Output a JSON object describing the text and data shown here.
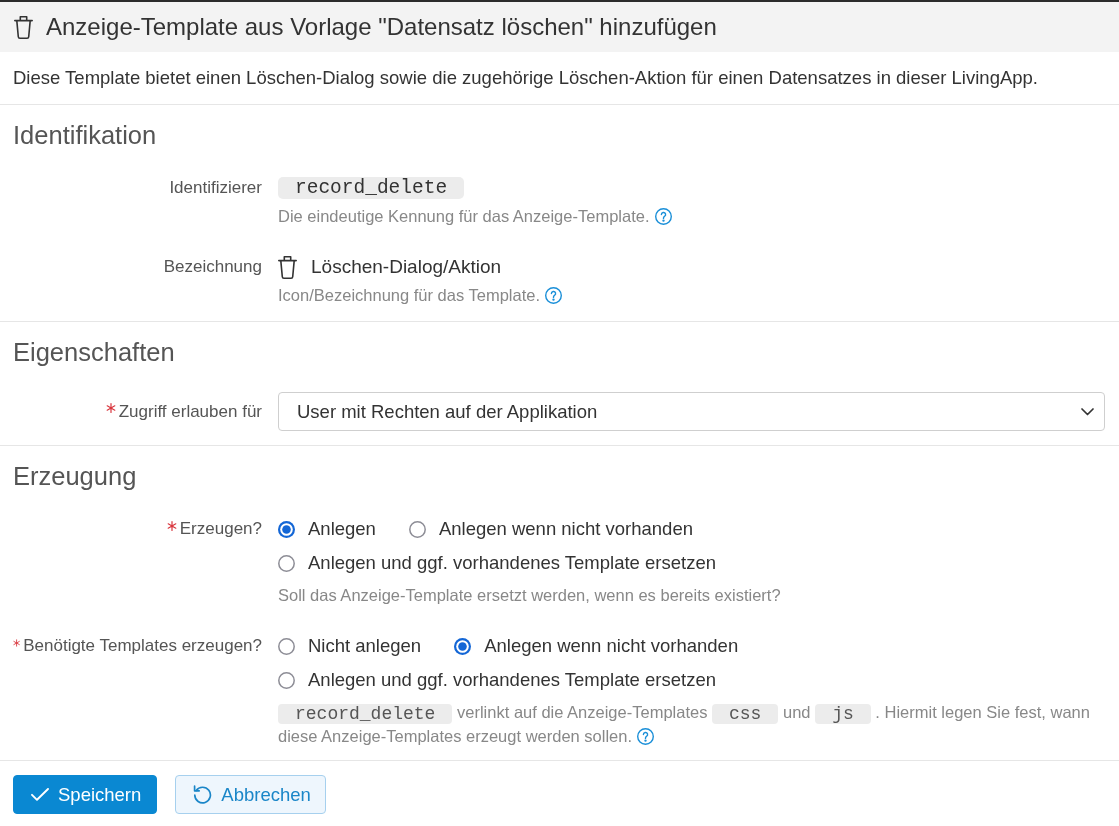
{
  "dialog": {
    "title": "Anzeige-Template aus Vorlage \"Datensatz löschen\" hinzufügen",
    "description": "Diese Template bietet einen Löschen-Dialog sowie die zugehörige Löschen-Aktion für einen Datensatzes in dieser LivingApp."
  },
  "sections": [
    {
      "title": "Identifikation",
      "fields": [
        {
          "kind": "code",
          "label": "Identifizierer",
          "required": false,
          "value": "record_delete",
          "help": [
            {
              "kind": "text",
              "text": "Die eindeutige Kennung für das Anzeige-Template."
            }
          ],
          "help_icon": true
        },
        {
          "kind": "icon_text",
          "label": "Bezeichnung",
          "required": false,
          "value": "Löschen-Dialog/Aktion",
          "help": [
            {
              "kind": "text",
              "text": "Icon/Bezeichnung für das Template."
            }
          ],
          "help_icon": true
        }
      ]
    },
    {
      "title": "Eigenschaften",
      "fields": [
        {
          "kind": "select",
          "label": "Zugriff erlauben für",
          "required": true,
          "value": "User mit Rechten auf der Applikation"
        }
      ]
    },
    {
      "title": "Erzeugung",
      "fields": [
        {
          "kind": "radio",
          "label": "Erzeugen?",
          "required": true,
          "options": [
            {
              "label": "Anlegen",
              "selected": true
            },
            {
              "label": "Anlegen wenn nicht vorhanden",
              "selected": false
            },
            {
              "label": "Anlegen und ggf. vorhandenes Template ersetzen",
              "selected": false
            }
          ],
          "help": [
            {
              "kind": "text",
              "text": "Soll das Anzeige-Template ersetzt werden, wenn es bereits existiert?"
            }
          ],
          "help_icon": false
        },
        {
          "kind": "radio",
          "label": "Benötigte Templates erzeugen?",
          "required": true,
          "options": [
            {
              "label": "Nicht anlegen",
              "selected": false
            },
            {
              "label": "Anlegen wenn nicht vorhanden",
              "selected": true
            },
            {
              "label": "Anlegen und ggf. vorhandenes Template ersetzen",
              "selected": false
            }
          ],
          "help": [
            {
              "kind": "code",
              "text": "record_delete"
            },
            {
              "kind": "text",
              "text": "verlinkt auf die Anzeige-Templates"
            },
            {
              "kind": "code",
              "text": "css"
            },
            {
              "kind": "text",
              "text": "und"
            },
            {
              "kind": "code",
              "text": "js"
            },
            {
              "kind": "text",
              "text": ". Hiermit legen Sie fest, wann diese Anzeige-Templates erzeugt werden sollen."
            }
          ],
          "help_icon": true
        }
      ]
    }
  ],
  "buttons": [
    {
      "kind": "save",
      "label": "Speichern"
    },
    {
      "kind": "cancel",
      "label": "Abbrechen"
    }
  ]
}
